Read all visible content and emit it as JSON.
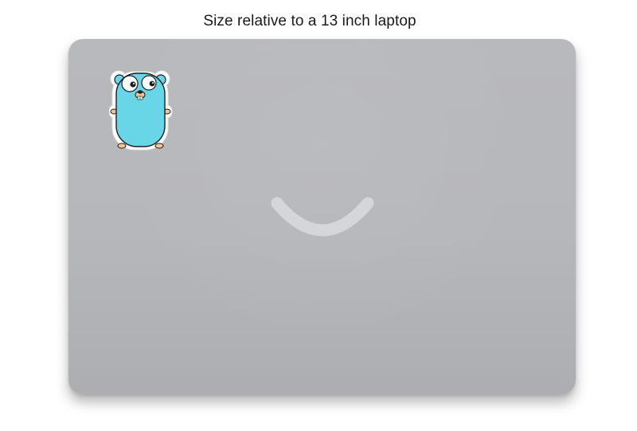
{
  "caption": "Size relative to a 13 inch laptop",
  "colors": {
    "laptop_body": "#b8b9bd",
    "smile": "#d4d6da",
    "gopher_blue": "#68d6e6",
    "gopher_outline": "#1e1e1e",
    "sticker_border": "#ffffff",
    "gopher_feet": "#f2c68e"
  },
  "icons": {
    "laptop_logo": "smile-logo-icon",
    "sticker": "go-gopher-icon"
  }
}
